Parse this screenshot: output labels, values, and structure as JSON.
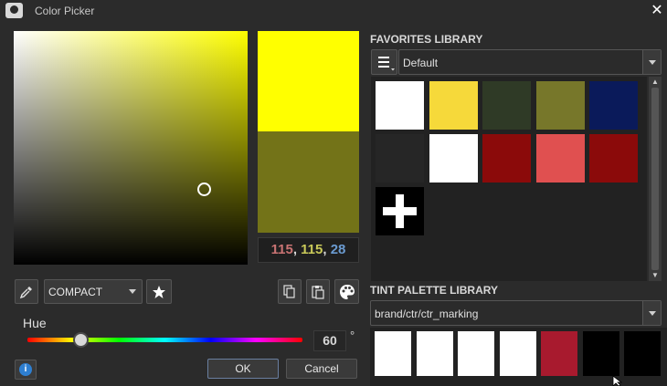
{
  "window": {
    "title": "Color Picker",
    "close_glyph": "✕"
  },
  "colors": {
    "current": "#ffff00",
    "previous": "#737318",
    "accent_blue": "#2e7fd1"
  },
  "readout": {
    "r": "115",
    "g": "115",
    "b": "28",
    "sep": ", "
  },
  "toolbar": {
    "mode_label": "COMPACT",
    "icons": [
      "eyedropper-icon",
      "star-icon",
      "copy-icon",
      "paste-icon",
      "palette-icon"
    ]
  },
  "hue": {
    "label": "Hue",
    "value": "60",
    "unit": "°",
    "fraction": 0.1667
  },
  "buttons": {
    "info_glyph": "i",
    "ok": "OK",
    "cancel": "Cancel"
  },
  "favorites": {
    "title": "FAVORITES LIBRARY",
    "selected": "Default",
    "swatches": [
      "#ffffff",
      "#f6d93a",
      "#2f3a26",
      "#77772a",
      "#0a1a5a",
      "#262626",
      "#ffffff",
      "#8b0a0a",
      "#e05050",
      "#8b0a0a"
    ],
    "add_glyph": "+"
  },
  "tint": {
    "title": "TINT PALETTE LIBRARY",
    "selected": "brand/ctr/ctr_marking",
    "swatches": [
      "#ffffff",
      "#ffffff",
      "#ffffff",
      "#ffffff",
      "#a81a2e",
      "#000000",
      "#000000"
    ]
  }
}
